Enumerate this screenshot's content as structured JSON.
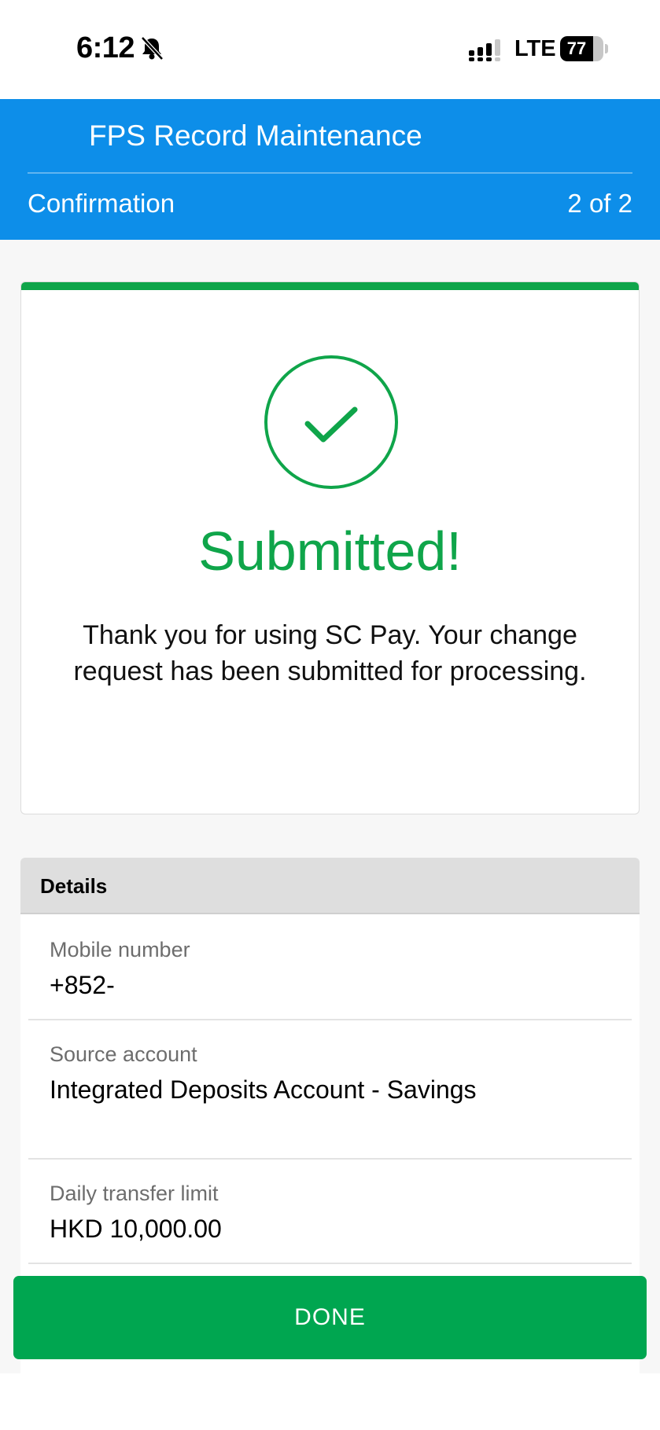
{
  "status_bar": {
    "time": "6:12",
    "network": "LTE",
    "battery_percent": "77",
    "battery_level": 0.77,
    "icons": [
      "bell-slash-icon",
      "signal-icon",
      "battery-icon"
    ]
  },
  "header": {
    "title": "FPS Record Maintenance",
    "step_label": "Confirmation",
    "step_count": "2 of 2"
  },
  "result": {
    "icon": "checkmark-circle-icon",
    "title": "Submitted!",
    "message": "Thank you for using SC Pay. Your change request has been submitted for processing."
  },
  "details": {
    "heading": "Details",
    "rows": [
      {
        "label": "Mobile number",
        "value": "+852-"
      },
      {
        "label": "Source account",
        "value": "Integrated Deposits Account - Savings"
      },
      {
        "label": "Daily transfer limit",
        "value": "HKD 10,000.00"
      }
    ]
  },
  "actions": {
    "done_label": "DONE"
  },
  "colors": {
    "header_blue": "#0d8ee9",
    "success_green": "#0fa54a",
    "button_green": "#00a650"
  }
}
